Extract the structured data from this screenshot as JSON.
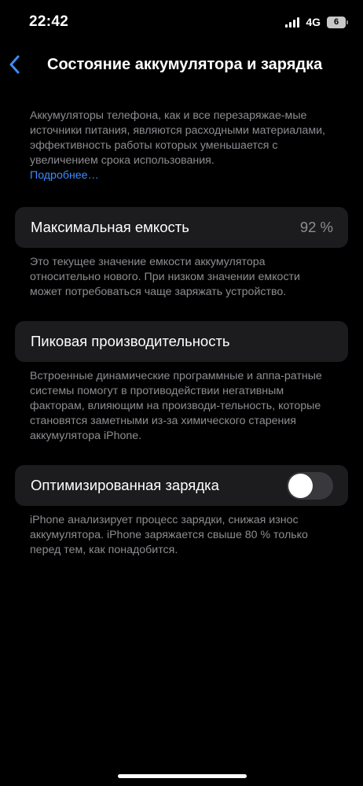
{
  "status_bar": {
    "time": "22:42",
    "network": "4G",
    "battery": "6"
  },
  "nav": {
    "title": "Состояние аккумулятора и зарядка",
    "back_icon": "chevron-left-icon"
  },
  "intro": {
    "text": "Аккумуляторы телефона, как и все перезаряжае-мые источники питания, являются расходными материалами, эффективность работы которых уменьшается с увеличением срока использования.",
    "link": "Подробнее…"
  },
  "maximum_capacity": {
    "label": "Максимальная емкость",
    "value": "92 %",
    "footnote": "Это текущее значение емкости аккумулятора относительно нового. При низком значении емкости может потребоваться чаще заряжать устройство."
  },
  "peak_performance": {
    "label": "Пиковая производительность",
    "footnote": "Встроенные динамические программные и аппа-ратные системы помогут в противодействии негативным факторам, влияющим на производи-тельность, которые становятся заметными из-за химического старения аккумулятора iPhone."
  },
  "optimized_charging": {
    "label": "Оптимизированная зарядка",
    "enabled": false,
    "footnote": "iPhone анализирует процесс зарядки, снижая износ аккумулятора. iPhone заряжается свыше 80 % только перед тем, как понадобится."
  },
  "colors": {
    "background": "#000000",
    "cell": "#1c1c1e",
    "secondary_text": "#8d8d92",
    "link": "#3c8cff",
    "back_chevron": "#3c8cff",
    "toggle_off": "#39393d"
  }
}
